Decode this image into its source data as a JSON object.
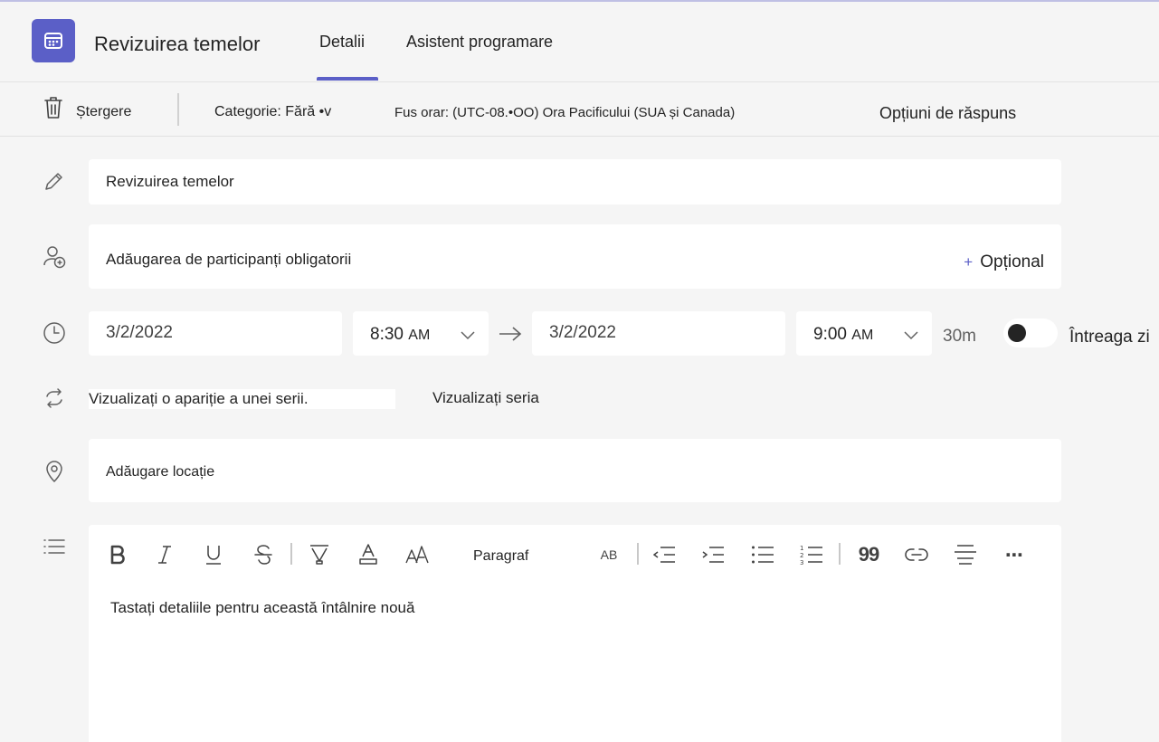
{
  "header": {
    "title": "Revizuirea temelor",
    "tabs": [
      {
        "label": "Detalii"
      },
      {
        "label": "Asistent programare"
      }
    ]
  },
  "toolbar": {
    "delete_label": "Ștergere",
    "category": "Categorie: Fără •v",
    "timezone": "Fus orar: (UTC-08.•OO) Ora Pacificului (SUA și Canada)",
    "response_options": "Opțiuni de răspuns"
  },
  "form": {
    "subject": "Revizuirea temelor",
    "attendees_placeholder": "Adăugarea de participanți obligatorii",
    "optional_label": "Opțional",
    "optional_plus": "+",
    "start_date": "3/2/2022",
    "start_time": "8:30",
    "start_ampm": "AM",
    "end_date": "3/2/2022",
    "end_time": "9:00",
    "end_ampm": "AM",
    "duration": "30m",
    "all_day_label": "Întreaga zi",
    "recurrence_text": "Vizualizați o apariție a unei serii.",
    "view_series_link": "Vizualizați seria",
    "location_placeholder": "Adăugare locație"
  },
  "editor": {
    "paragraph_label": "Paragraf",
    "body_placeholder": "Tastați detaliile pentru această întâlnire nouă",
    "spell_label": "AB",
    "more_label": "⋯",
    "quote_label": "99"
  },
  "colors": {
    "accent": "#5b5fc7",
    "background": "#f5f5f5",
    "field": "#ffffff"
  }
}
